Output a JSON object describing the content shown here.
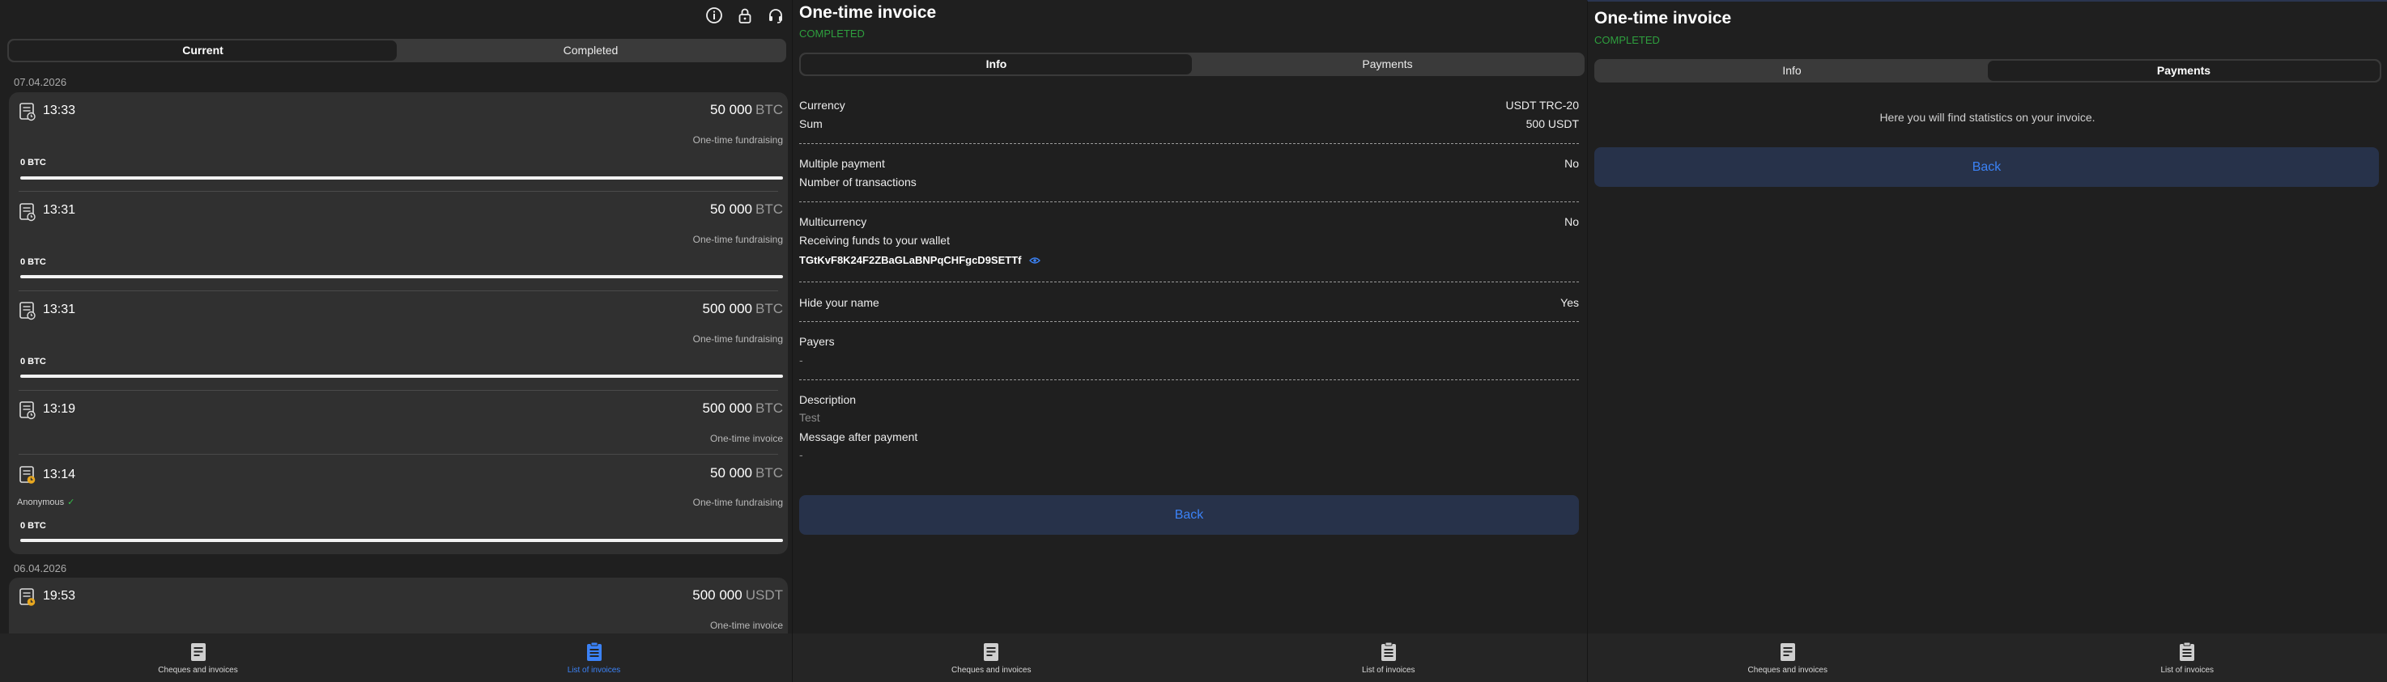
{
  "colors": {
    "accent": "#3b82f6",
    "completed": "#2e9f3e",
    "card": "#303030",
    "background": "#1f1f1f"
  },
  "list": {
    "top_icons": [
      "info-icon",
      "lock-icon",
      "headset-icon"
    ],
    "tabs": [
      "Current",
      "Completed"
    ],
    "active_tab": "Current",
    "groups": [
      {
        "date": "07.04.2026",
        "items": [
          {
            "time": "13:33",
            "amount": "50 000",
            "currency": "BTC",
            "kind": "One-time fundraising",
            "collected": "0 BTC",
            "progress": 0
          },
          {
            "time": "13:31",
            "amount": "50 000",
            "currency": "BTC",
            "kind": "One-time fundraising",
            "collected": "0 BTC",
            "progress": 0
          },
          {
            "time": "13:31",
            "amount": "500 000",
            "currency": "BTC",
            "kind": "One-time fundraising",
            "collected": "0 BTC",
            "progress": 0
          },
          {
            "time": "13:19",
            "amount": "500 000",
            "currency": "BTC",
            "kind": "One-time invoice"
          },
          {
            "time": "13:14",
            "amount": "50 000",
            "currency": "BTC",
            "kind": "One-time fundraising",
            "anonymous": "Anonymous",
            "collected": "0 BTC",
            "progress": 0
          }
        ]
      },
      {
        "date": "06.04.2026",
        "items": [
          {
            "time": "19:53",
            "amount": "500 000",
            "currency": "USDT",
            "kind": "One-time invoice"
          }
        ]
      }
    ]
  },
  "nav": {
    "cheques": "Cheques and invoices",
    "invoices": "List of invoices"
  },
  "invoice": {
    "title": "One-time invoice",
    "status": "COMPLETED",
    "tabs": [
      "Info",
      "Payments"
    ],
    "currency_label": "Currency",
    "currency_value": "USDT TRC-20",
    "sum_label": "Sum",
    "sum_value": "500 USDT",
    "multiple_label": "Multiple payment",
    "multiple_value": "No",
    "transactions_label": "Number of transactions",
    "multicurrency_label": "Multicurrency",
    "multicurrency_value": "No",
    "receiving_label": "Receiving funds to your wallet",
    "wallet": "TGtKvF8K24F2ZBaGLaBNPqCHFgcD9SETTf",
    "hide_label": "Hide your name",
    "hide_value": "Yes",
    "payers_label": "Payers",
    "payers_value": "-",
    "description_label": "Description",
    "description_value": "Test",
    "message_label": "Message after payment",
    "message_value": "-",
    "back": "Back"
  },
  "payments": {
    "title": "One-time invoice",
    "status": "COMPLETED",
    "tabs": [
      "Info",
      "Payments"
    ],
    "note": "Here you will find statistics on your invoice.",
    "back": "Back"
  }
}
